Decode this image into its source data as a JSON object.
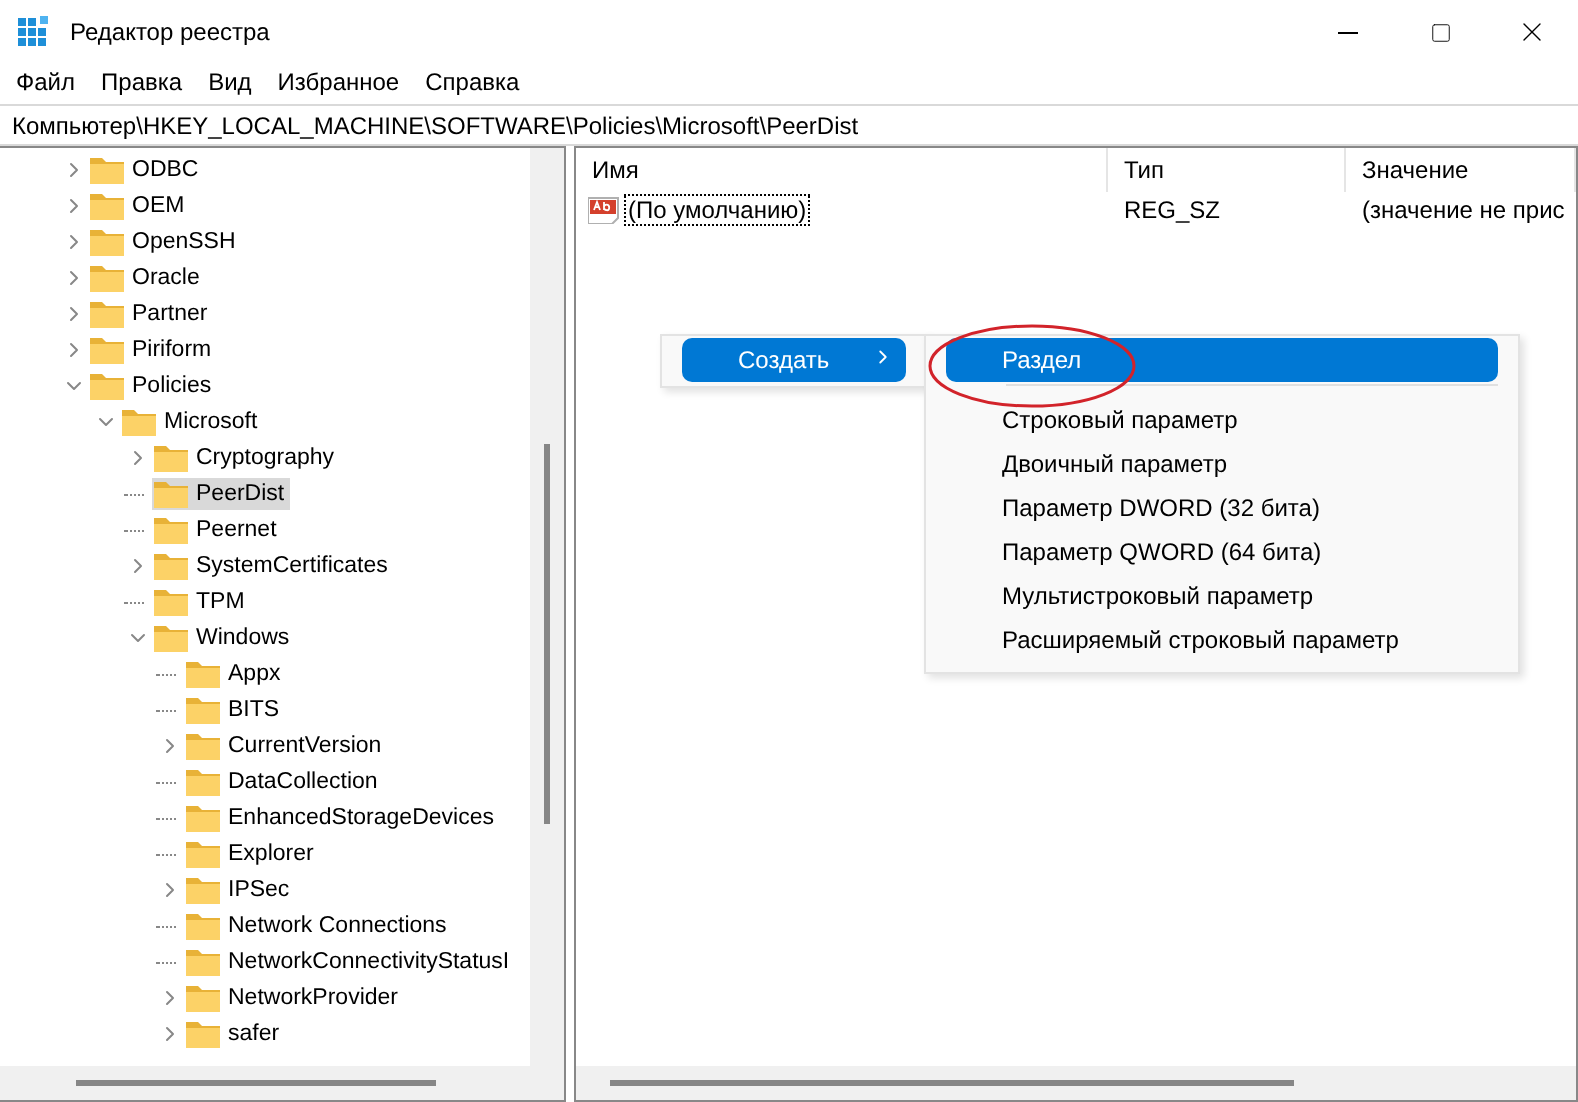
{
  "window": {
    "title": "Редактор реестра"
  },
  "menu": [
    {
      "label": "Файл"
    },
    {
      "label": "Правка"
    },
    {
      "label": "Вид"
    },
    {
      "label": "Избранное"
    },
    {
      "label": "Справка"
    }
  ],
  "address": "Компьютер\\HKEY_LOCAL_MACHINE\\SOFTWARE\\Policies\\Microsoft\\PeerDist",
  "tree": [
    {
      "label": "ODBC",
      "kind": "branch",
      "expanded": false,
      "selected": false
    },
    {
      "label": "OEM",
      "kind": "branch",
      "expanded": false,
      "selected": false
    },
    {
      "label": "OpenSSH",
      "kind": "branch",
      "expanded": false,
      "selected": false
    },
    {
      "label": "Oracle",
      "kind": "branch",
      "expanded": false,
      "selected": false
    },
    {
      "label": "Partner",
      "kind": "branch",
      "expanded": false,
      "selected": false
    },
    {
      "label": "Piriform",
      "kind": "branch",
      "expanded": false,
      "selected": false
    },
    {
      "label": "Policies",
      "kind": "branch",
      "expanded": true,
      "selected": false,
      "children": [
        {
          "label": "Microsoft",
          "kind": "branch",
          "expanded": true,
          "selected": false,
          "children": [
            {
              "label": "Cryptography",
              "kind": "branch",
              "expanded": false,
              "selected": false
            },
            {
              "label": "PeerDist",
              "kind": "leaf",
              "selected": true
            },
            {
              "label": "Peernet",
              "kind": "leaf",
              "selected": false
            },
            {
              "label": "SystemCertificates",
              "kind": "branch",
              "expanded": false,
              "selected": false
            },
            {
              "label": "TPM",
              "kind": "leaf",
              "selected": false
            },
            {
              "label": "Windows",
              "kind": "branch",
              "expanded": true,
              "selected": false,
              "children": [
                {
                  "label": "Appx",
                  "kind": "leaf",
                  "selected": false
                },
                {
                  "label": "BITS",
                  "kind": "leaf",
                  "selected": false
                },
                {
                  "label": "CurrentVersion",
                  "kind": "branch",
                  "expanded": false,
                  "selected": false
                },
                {
                  "label": "DataCollection",
                  "kind": "leaf",
                  "selected": false
                },
                {
                  "label": "EnhancedStorageDevices",
                  "kind": "leaf",
                  "selected": false
                },
                {
                  "label": "Explorer",
                  "kind": "leaf",
                  "selected": false
                },
                {
                  "label": "IPSec",
                  "kind": "branch",
                  "expanded": false,
                  "selected": false
                },
                {
                  "label": "Network Connections",
                  "kind": "leaf",
                  "selected": false
                },
                {
                  "label": "NetworkConnectivityStatusI",
                  "kind": "leaf",
                  "selected": false
                },
                {
                  "label": "NetworkProvider",
                  "kind": "branch",
                  "expanded": false,
                  "selected": false
                },
                {
                  "label": "safer",
                  "kind": "branch",
                  "expanded": false,
                  "selected": false
                }
              ]
            }
          ]
        }
      ]
    }
  ],
  "values_table": {
    "columns": [
      {
        "label": "Имя"
      },
      {
        "label": "Тип"
      },
      {
        "label": "Значение"
      }
    ],
    "rows": [
      {
        "name": "(По умолчанию)",
        "type": "REG_SZ",
        "value": "(значение не прис",
        "selected": true
      }
    ]
  },
  "context_menu": {
    "items": [
      {
        "label": "Создать",
        "selected": true,
        "has_submenu": true
      }
    ]
  },
  "submenu": {
    "items": [
      {
        "label": "Раздел",
        "selected": true,
        "kind": "item"
      },
      {
        "kind": "separator"
      },
      {
        "label": "Строковый параметр",
        "selected": false,
        "kind": "item"
      },
      {
        "label": "Двоичный параметр",
        "selected": false,
        "kind": "item"
      },
      {
        "label": "Параметр DWORD (32 бита)",
        "selected": false,
        "kind": "item"
      },
      {
        "label": "Параметр QWORD (64 бита)",
        "selected": false,
        "kind": "item"
      },
      {
        "label": "Мультистроковый параметр",
        "selected": false,
        "kind": "item"
      },
      {
        "label": "Расширяемый строковый параметр",
        "selected": false,
        "kind": "item"
      }
    ]
  }
}
